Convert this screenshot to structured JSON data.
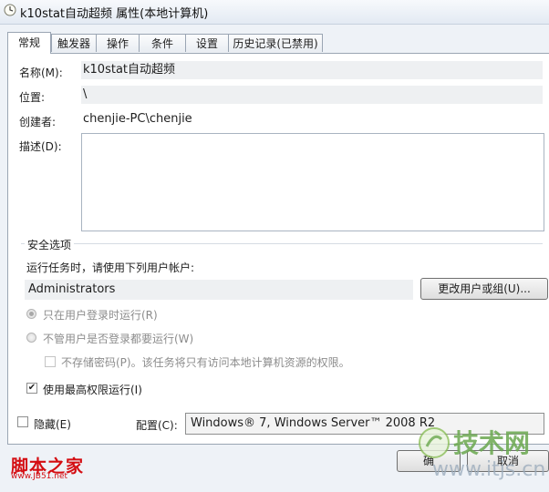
{
  "window": {
    "title": "k10stat自动超频 属性(本地计算机)"
  },
  "tabs": [
    {
      "label": "常规"
    },
    {
      "label": "触发器"
    },
    {
      "label": "操作"
    },
    {
      "label": "条件"
    },
    {
      "label": "设置"
    },
    {
      "label": "历史记录(已禁用)"
    }
  ],
  "general": {
    "name_label": "名称(M):",
    "name_value": "k10stat自动超频",
    "location_label": "位置:",
    "location_value": "\\",
    "author_label": "创建者:",
    "author_value": "chenjie-PC\\chenjie",
    "description_label": "描述(D):",
    "description_value": ""
  },
  "security": {
    "group_label": "安全选项",
    "run_as_label": "运行任务时，请使用下列用户帐户:",
    "account": "Administrators",
    "change_user_button": "更改用户或组(U)...",
    "radio_logged_on": "只在用户登录时运行(R)",
    "radio_whether_logged": "不管用户是否登录都要运行(W)",
    "no_store_password": "不存储密码(P)。该任务将只有访问本地计算机资源的权限。",
    "highest_privileges": "使用最高权限运行(I)",
    "highest_privileges_checked": true
  },
  "bottom": {
    "hidden_label": "隐藏(E)",
    "hidden_checked": false,
    "configure_label": "配置(C):",
    "configure_value": "Windows® 7, Windows Server™ 2008 R2"
  },
  "footer": {
    "ok_partial": "确",
    "cancel_partial": "取消"
  },
  "watermarks": {
    "left_main": "脚本之家",
    "left_sub": "www.JB51.net",
    "right_main": "技术网",
    "right_sub": "www.itjs.cn"
  },
  "colors": {
    "accent_watermark_left": "#d40d12",
    "accent_watermark_right": "#6aa84f"
  }
}
